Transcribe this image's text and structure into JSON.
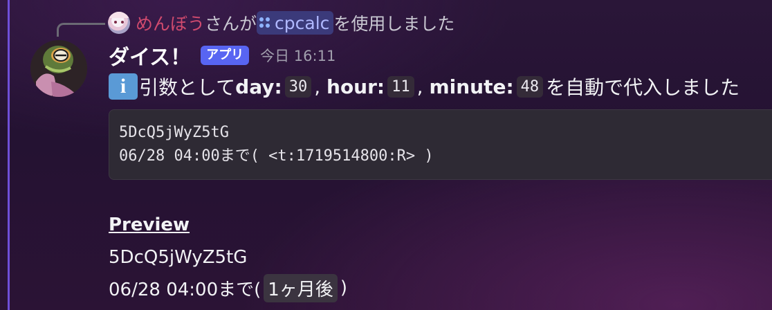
{
  "reply": {
    "user": "めんぼう",
    "text_before": "さんが",
    "command": "cpcalc",
    "text_after": "を使用しました"
  },
  "message": {
    "username": "ダイス！",
    "badge": "アプリ",
    "timestamp": "今日 16:11",
    "content": {
      "intro": "引数として",
      "info_icon": "i",
      "params": [
        {
          "label": "day:",
          "value": "30",
          "sep": ","
        },
        {
          "label": "hour:",
          "value": "11",
          "sep": ","
        },
        {
          "label": "minute:",
          "value": "48",
          "sep": ""
        }
      ],
      "outro": "を自動で代入しました"
    },
    "code_block": {
      "line1": "5DcQ5jWyZ5tG",
      "line2": "06/28 04:00まで( <t:1719514800:R> )"
    },
    "preview": {
      "heading": "Preview",
      "line1": "5DcQ5jWyZ5tG",
      "line2_prefix": "06/28 04:00まで(",
      "relative": "1ヶ月後",
      "line2_suffix": ")"
    }
  },
  "icons": {
    "command": "slash-command-icon",
    "info": "information-icon"
  },
  "colors": {
    "highlight_bar": "#6f4fd8",
    "replied_user": "#d04a6e",
    "app_badge": "#5865f2",
    "command_pill_bg": "#3b3a7a",
    "command_pill_text": "#b0b8ff",
    "info_icon": "#5a9ad6"
  }
}
